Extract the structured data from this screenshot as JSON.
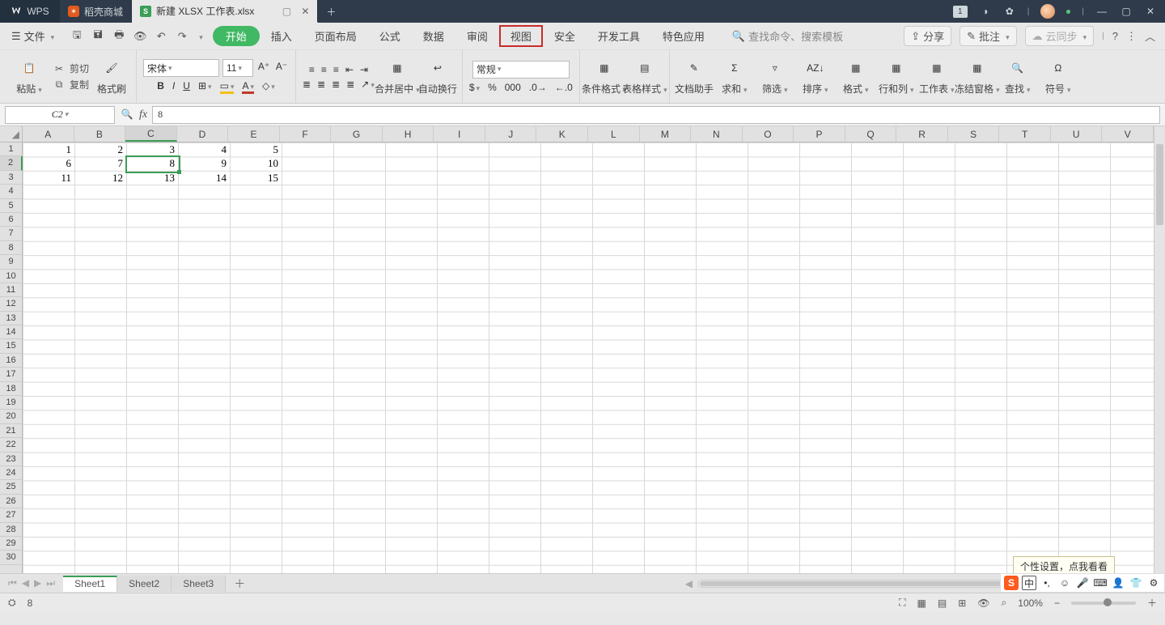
{
  "titlebar": {
    "wps_label": "WPS",
    "docshop_label": "稻壳商城",
    "file_tab_label": "新建 XLSX 工作表.xlsx",
    "notif_count": "1"
  },
  "menu": {
    "file": "文件",
    "tabs": [
      "开始",
      "插入",
      "页面布局",
      "公式",
      "数据",
      "审阅",
      "视图",
      "安全",
      "开发工具",
      "特色应用"
    ],
    "search_placeholder": "查找命令、搜索模板",
    "share": "分享",
    "annotate": "批注",
    "cloud_sync": "云同步"
  },
  "ribbon": {
    "paste": "粘贴",
    "cut": "剪切",
    "copy": "复制",
    "format_painter": "格式刷",
    "font_name": "宋体",
    "font_size": "11",
    "merge_center": "合并居中",
    "auto_wrap": "自动换行",
    "number_format": "常规",
    "cond_format": "条件格式",
    "table_style": "表格样式",
    "doc_assist": "文档助手",
    "sum": "求和",
    "filter": "筛选",
    "sort": "排序",
    "format": "格式",
    "row_col": "行和列",
    "worksheet": "工作表",
    "freeze": "冻结窗格",
    "find": "查找",
    "symbol": "符号"
  },
  "formula_bar": {
    "name_box": "C2",
    "formula": "8"
  },
  "grid": {
    "cols": [
      "A",
      "B",
      "C",
      "D",
      "E",
      "F",
      "G",
      "H",
      "I",
      "J",
      "K",
      "L",
      "M",
      "N",
      "O",
      "P",
      "Q",
      "R",
      "S",
      "T",
      "U",
      "V"
    ],
    "selected_col": "C",
    "selected_row": 2,
    "cells": {
      "A1": "1",
      "B1": "2",
      "C1": "3",
      "D1": "4",
      "E1": "5",
      "A2": "6",
      "B2": "7",
      "C2": "8",
      "D2": "9",
      "E2": "10",
      "A3": "11",
      "B3": "12",
      "C3": "13",
      "D3": "14",
      "E3": "15"
    }
  },
  "sheets": {
    "tabs": [
      "Sheet1",
      "Sheet2",
      "Sheet3"
    ],
    "active": 0
  },
  "statusbar": {
    "value": "8",
    "zoom": "100%"
  },
  "tooltip": "个性设置，点我看看",
  "ime": {
    "zh": "中"
  }
}
